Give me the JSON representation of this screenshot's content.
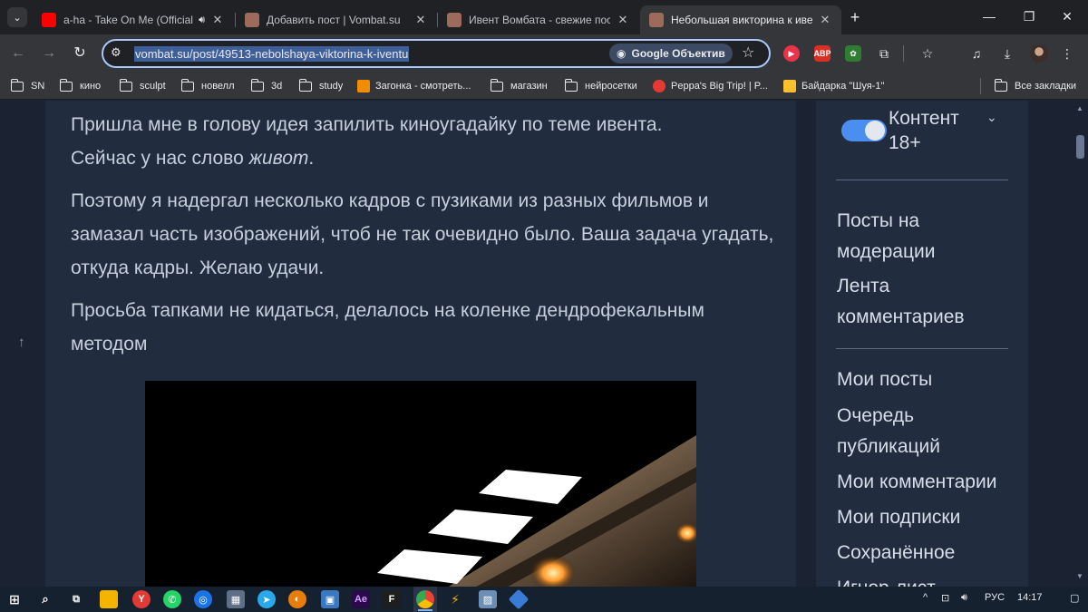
{
  "tabs": [
    {
      "title": "a-ha - Take On Me (Official",
      "favicon_color": "#ff0000",
      "audio_icon": "speaker-icon"
    },
    {
      "title": "Добавить пост | Vombat.su",
      "favicon_color": "#9c6b5a"
    },
    {
      "title": "Ивент Вомбата - свежие посты",
      "favicon_color": "#9c6b5a"
    },
    {
      "title": "Небольшая викторина к ивенту",
      "favicon_color": "#9c6b5a",
      "active": true
    }
  ],
  "address_bar": {
    "url": "vombat.su/post/49513-nebolshaya-viktorina-k-iventu",
    "lens_label": "Google Объектив"
  },
  "bookmarks": {
    "items": [
      "SN",
      "кино",
      "sculpt",
      "новелл",
      "3d",
      "study",
      "Загонка - смотреть...",
      "магазин",
      "нейросетки",
      "Peppa's Big Trip! | P...",
      "Байдарка \"Шуя-1\""
    ],
    "all_bookmarks": "Все закладки"
  },
  "post": {
    "p1_line1": "Пришла мне в голову идея запилить киноугадайку по теме ивента.",
    "p1_line2_prefix": "Сейчас у нас слово ",
    "p1_line2_em": "живот",
    "p1_line2_suffix": ".",
    "p2": "Поэтому я надергал несколько кадров с пузиками из разных фильмов и замазал часть изображений, чтоб не так очевидно было. Ваша задача угадать, откуда кадры. Желаю удачи.",
    "p3": "Просьба тапками не кидаться, делалось на коленке дендрофекальным методом"
  },
  "sidebar": {
    "nsfw_toggle_label": "Контент 18+",
    "nsfw_enabled": true,
    "group1": [
      "Посты на модерации",
      "Лента комментариев"
    ],
    "group2": [
      "Мои посты",
      "Очередь публикаций",
      "Мои комментарии",
      "Мои подписки",
      "Сохранённое",
      "Игнор-лист"
    ]
  },
  "taskbar": {
    "language": "РУС",
    "time": "14:17"
  }
}
